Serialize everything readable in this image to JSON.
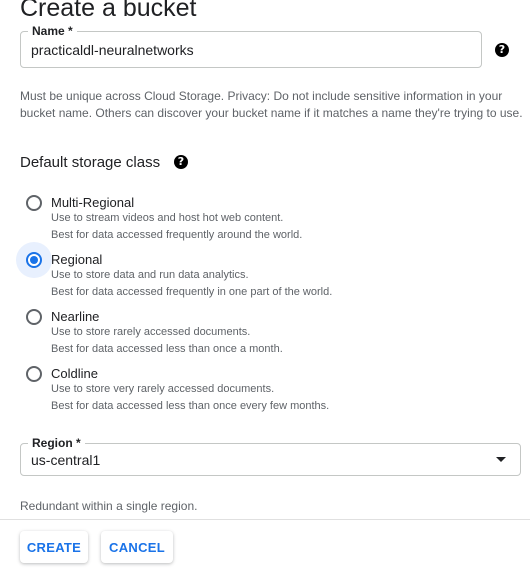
{
  "page": {
    "title": "Create a bucket"
  },
  "name_field": {
    "label": "Name *",
    "value": "practicaldl-neuralnetworks",
    "help_icon": "help-circle-icon",
    "hint_line1": "Must be unique across Cloud Storage. Privacy: Do not include sensitive information in your",
    "hint_line2": "bucket name. Others can discover your bucket name if it matches a name they're trying to use."
  },
  "storage_class": {
    "title": "Default storage class",
    "help_icon": "help-circle-icon",
    "selected": "Regional",
    "options": [
      {
        "label": "Multi-Regional",
        "desc1": "Use to stream videos and host hot web content.",
        "desc2": "Best for data accessed frequently around the world.",
        "checked": false
      },
      {
        "label": "Regional",
        "desc1": "Use to store data and run data analytics.",
        "desc2": "Best for data accessed frequently in one part of the world.",
        "checked": true
      },
      {
        "label": "Nearline",
        "desc1": "Use to store rarely accessed documents.",
        "desc2": "Best for data accessed less than once a month.",
        "checked": false
      },
      {
        "label": "Coldline",
        "desc1": "Use to store very rarely accessed documents.",
        "desc2": "Best for data accessed less than once every few months.",
        "checked": false
      }
    ]
  },
  "region_field": {
    "label": "Region *",
    "value": "us-central1",
    "hint": "Redundant within a single region."
  },
  "actions": {
    "create": "CREATE",
    "cancel": "CANCEL"
  },
  "colors": {
    "accent": "#1a73e8",
    "text": "#202124",
    "muted": "#5f6368",
    "halo": "#e8f0fe"
  }
}
